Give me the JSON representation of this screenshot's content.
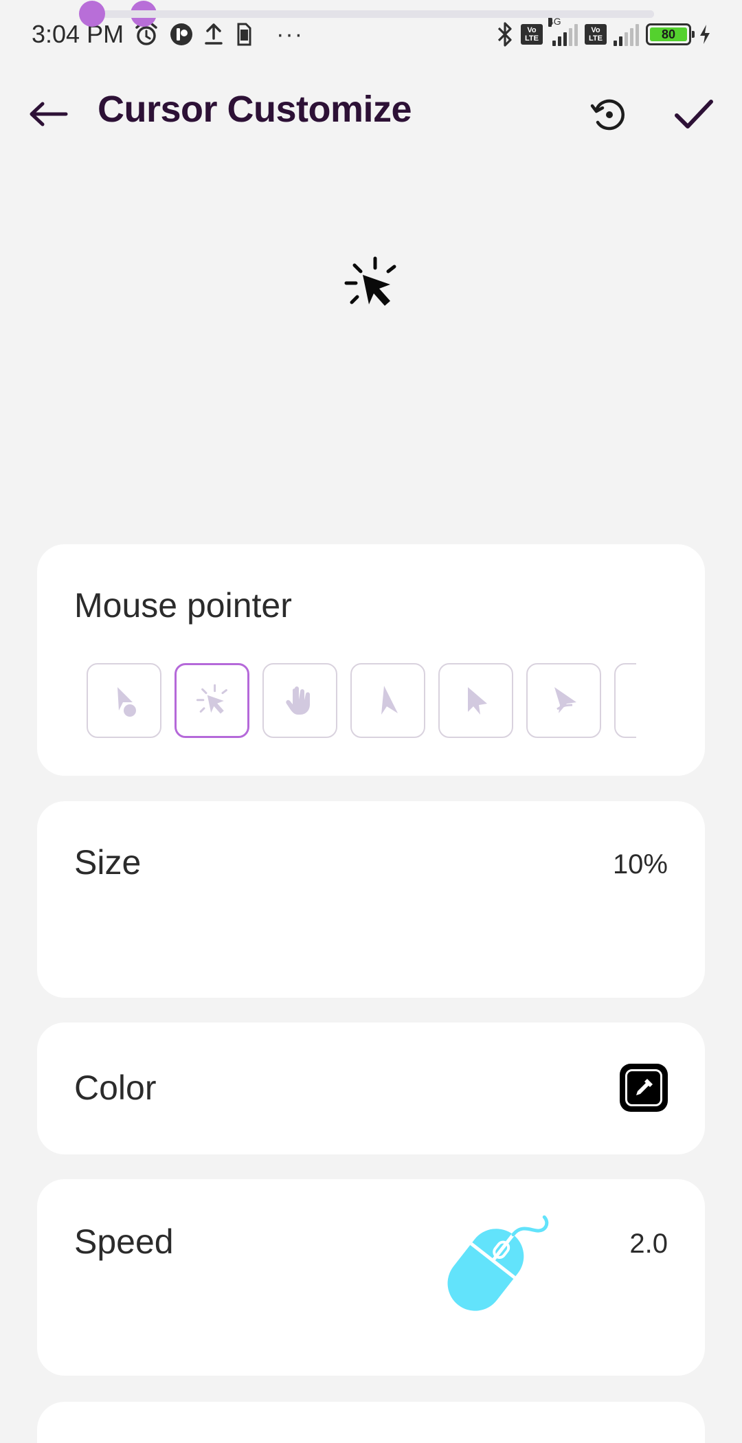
{
  "status_bar": {
    "time": "3:04 PM",
    "more": "···",
    "network": "4G",
    "volte": "Vo LTE",
    "battery": "80"
  },
  "app_bar": {
    "title": "Cursor Customize"
  },
  "mouse_pointer": {
    "label": "Mouse pointer",
    "options": [
      {
        "icon": "pointer-dot-icon",
        "selected": false
      },
      {
        "icon": "pointer-click-icon",
        "selected": true
      },
      {
        "icon": "pointer-hand-icon",
        "selected": false
      },
      {
        "icon": "pointer-arrow-icon",
        "selected": false
      },
      {
        "icon": "pointer-arrow-bold-icon",
        "selected": false
      },
      {
        "icon": "pointer-arrow-swoosh-icon",
        "selected": false
      },
      {
        "icon": "pointer-arrow-outline-icon",
        "selected": false
      }
    ]
  },
  "size": {
    "label": "Size",
    "value": "10%",
    "fraction": 0.1
  },
  "color": {
    "label": "Color"
  },
  "speed": {
    "label": "Speed",
    "value": "2.0",
    "fraction": 0.0
  },
  "colors": {
    "accent": "#b86ed8",
    "title": "#2d1136",
    "background": "#f3f3f3",
    "mouse_decoration": "#62e3fb"
  }
}
